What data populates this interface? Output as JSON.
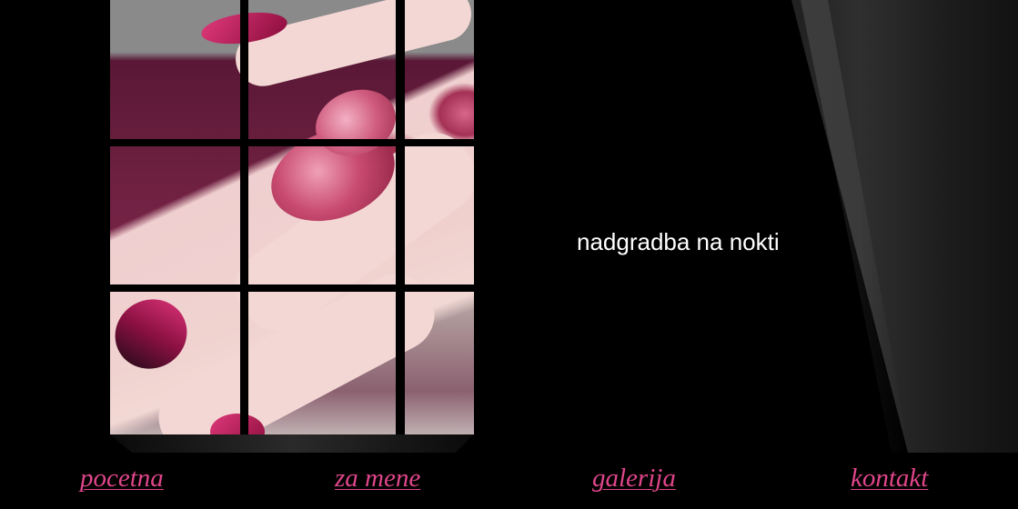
{
  "headline": "nadgradba na nokti",
  "nav": {
    "items": [
      {
        "label": "pocetna"
      },
      {
        "label": "za mene"
      },
      {
        "label": "galerija"
      },
      {
        "label": "kontakt"
      }
    ]
  },
  "colors": {
    "background": "#000000",
    "nav_link": "#e0468a",
    "headline": "#ffffff"
  }
}
